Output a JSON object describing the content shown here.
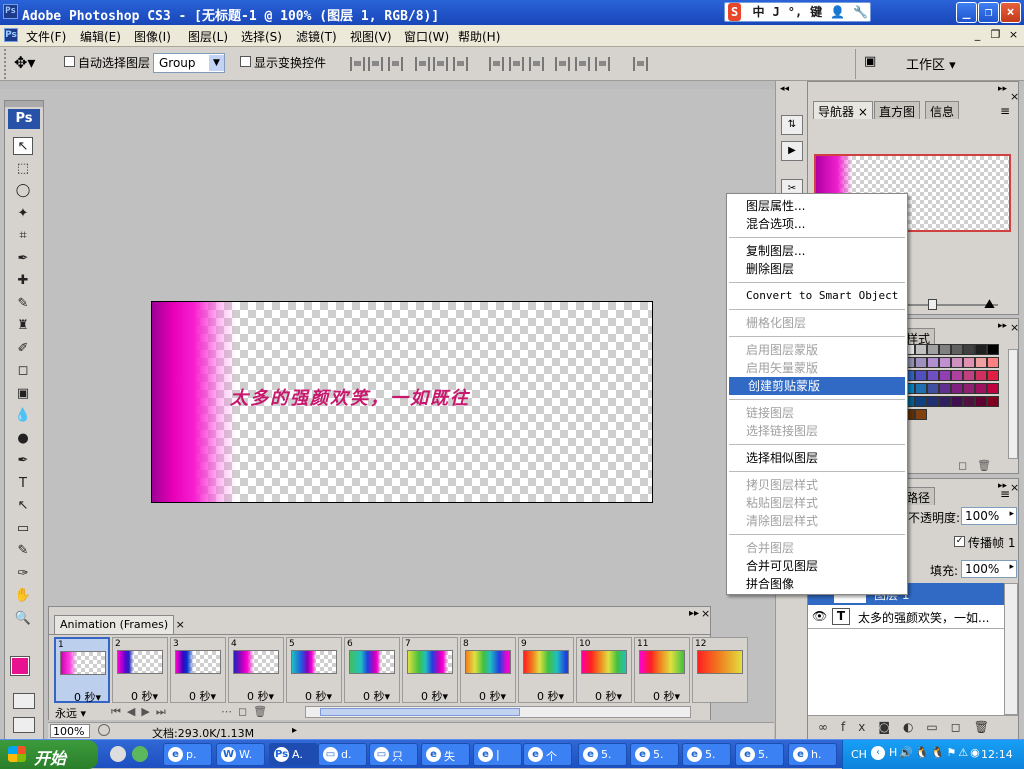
{
  "window": {
    "title": "Adobe Photoshop CS3 - [无标题-1 @ 100% (图层 1, RGB/8)]",
    "ps_icon": "Ps"
  },
  "ime_bar": {
    "label": "S",
    "items": [
      "中",
      "J",
      "°,",
      "键",
      "👤",
      "🔧"
    ]
  },
  "window_buttons": {
    "minimize": "_",
    "restore": "❐",
    "close": "×"
  },
  "menubar": {
    "doc_icon": "Ps",
    "items": [
      "文件(F)",
      "编辑(E)",
      "图像(I)",
      "图层(L)",
      "选择(S)",
      "滤镜(T)",
      "视图(V)",
      "窗口(W)",
      "帮助(H)"
    ],
    "doc_buttons": [
      "_",
      "❐",
      "×"
    ]
  },
  "options_bar": {
    "auto_select_label": "自动选择图层",
    "auto_select_value": "Group",
    "show_transform_label": "显示变换控件",
    "workspace_label": "工作区 ▾"
  },
  "toolbox": {
    "logo": "Ps"
  },
  "canvas": {
    "text": "太多的强颜欢笑，一如既往",
    "zoom": "100%"
  },
  "animation_panel": {
    "tab_label": "Animation (Frames)",
    "frames": [
      {
        "num": "1",
        "delay": "0 秒▾",
        "selected": true
      },
      {
        "num": "2",
        "delay": "0 秒▾"
      },
      {
        "num": "3",
        "delay": "0 秒▾"
      },
      {
        "num": "4",
        "delay": "0 秒▾"
      },
      {
        "num": "5",
        "delay": "0 秒▾"
      },
      {
        "num": "6",
        "delay": "0 秒▾"
      },
      {
        "num": "7",
        "delay": "0 秒▾"
      },
      {
        "num": "8",
        "delay": "0 秒▾"
      },
      {
        "num": "9",
        "delay": "0 秒▾"
      },
      {
        "num": "10",
        "delay": "0 秒▾"
      },
      {
        "num": "11",
        "delay": "0 秒▾"
      },
      {
        "num": "12",
        "delay": ""
      }
    ],
    "loop_label": "永远"
  },
  "status_bar": {
    "zoom": "100%",
    "doc_info": "文档:293.0K/1.13M"
  },
  "navigator_panel": {
    "tabs": [
      "导航器",
      "直方图",
      "信息"
    ]
  },
  "swatches_panel": {
    "tab": "样式"
  },
  "layers_panel": {
    "tab": "路径",
    "opacity_label": "不透明度:",
    "opacity_value": "100%",
    "propagate_label": "传播帧 1",
    "fill_label": "填充:",
    "fill_value": "100%",
    "layers": [
      {
        "name": "图层 1"
      },
      {
        "name": "太多的强颜欢笑，一如...",
        "type_icon": "T"
      }
    ]
  },
  "context_menu": {
    "groups": [
      [
        {
          "label": "图层属性...",
          "enabled": true
        },
        {
          "label": "混合选项...",
          "enabled": true
        }
      ],
      [
        {
          "label": "复制图层...",
          "enabled": true
        },
        {
          "label": "删除图层",
          "enabled": true
        }
      ],
      [
        {
          "label": "Convert to Smart Object",
          "enabled": true,
          "mono": true
        }
      ],
      [
        {
          "label": "栅格化图层",
          "enabled": false
        }
      ],
      [
        {
          "label": "启用图层蒙版",
          "enabled": false
        },
        {
          "label": "启用矢量蒙版",
          "enabled": false
        },
        {
          "label": "创建剪贴蒙版",
          "enabled": true,
          "highlighted": true
        }
      ],
      [
        {
          "label": "链接图层",
          "enabled": false
        },
        {
          "label": "选择链接图层",
          "enabled": false
        }
      ],
      [
        {
          "label": "选择相似图层",
          "enabled": true
        }
      ],
      [
        {
          "label": "拷贝图层样式",
          "enabled": false
        },
        {
          "label": "粘贴图层样式",
          "enabled": false
        },
        {
          "label": "清除图层样式",
          "enabled": false
        }
      ],
      [
        {
          "label": "合并图层",
          "enabled": false
        },
        {
          "label": "合并可见图层",
          "enabled": true
        },
        {
          "label": "拼合图像",
          "enabled": true
        }
      ]
    ]
  },
  "taskbar": {
    "start_label": "开始",
    "buttons": [
      {
        "label": "p.",
        "icon": "e"
      },
      {
        "label": "W.",
        "icon": "W"
      },
      {
        "label": "A.",
        "icon": "Ps",
        "active": true
      },
      {
        "label": "d.",
        "icon": "▭"
      },
      {
        "label": "只",
        "icon": "▭"
      },
      {
        "label": "失",
        "icon": "e"
      },
      {
        "label": "|",
        "icon": "e"
      },
      {
        "label": "个",
        "icon": "e"
      },
      {
        "label": "5.",
        "icon": "e"
      },
      {
        "label": "5.",
        "icon": "e"
      },
      {
        "label": "5.",
        "icon": "e"
      },
      {
        "label": "5.",
        "icon": "e"
      },
      {
        "label": "h.",
        "icon": "e"
      }
    ],
    "tray": {
      "lang": "CH",
      "clock": "12:14"
    }
  },
  "colors": {
    "accent": "#316ac5",
    "title_bar": "#1f56c8",
    "magenta": "#e800b8",
    "text_pink": "#c8186e"
  }
}
